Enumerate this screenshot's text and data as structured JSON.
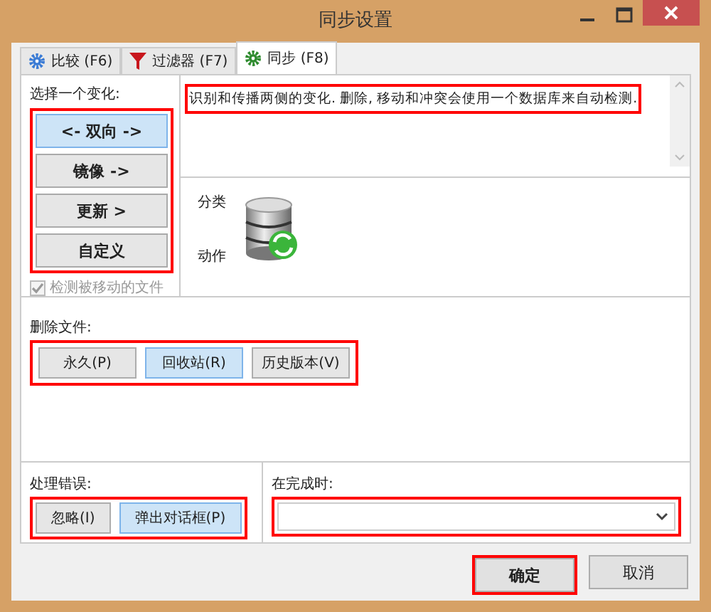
{
  "window": {
    "title": "同步设置"
  },
  "tabs": [
    {
      "label": "比较 (F6)",
      "selected": false
    },
    {
      "label": "过滤器 (F7)",
      "selected": false
    },
    {
      "label": "同步 (F8)",
      "selected": true
    }
  ],
  "variant": {
    "label": "选择一个变化:",
    "options": [
      {
        "label": "<- 双向 ->",
        "selected": true
      },
      {
        "label": "镜像 ->",
        "selected": false
      },
      {
        "label": "更新 >",
        "selected": false
      },
      {
        "label": "自定义",
        "selected": false
      }
    ],
    "detect_moved": {
      "label": "检测被移动的文件",
      "checked": true,
      "disabled": true
    }
  },
  "description": "识别和传播两侧的变化. 删除, 移动和冲突会使用一个数据库来自动检测.",
  "preview": {
    "labels": [
      "分类",
      "动作"
    ]
  },
  "deletion": {
    "label": "删除文件:",
    "options": [
      {
        "label": "永久(P)",
        "selected": false
      },
      {
        "label": "回收站(R)",
        "selected": true
      },
      {
        "label": "历史版本(V)",
        "selected": false
      }
    ]
  },
  "errors": {
    "label": "处理错误:",
    "options": [
      {
        "label": "忽略(I)",
        "selected": false
      },
      {
        "label": "弹出对话框(P)",
        "selected": true
      }
    ]
  },
  "on_completion": {
    "label": "在完成时:"
  },
  "buttons": [
    {
      "label": "确定",
      "kind": "primary"
    },
    {
      "label": "取消",
      "kind": "secondary"
    }
  ]
}
